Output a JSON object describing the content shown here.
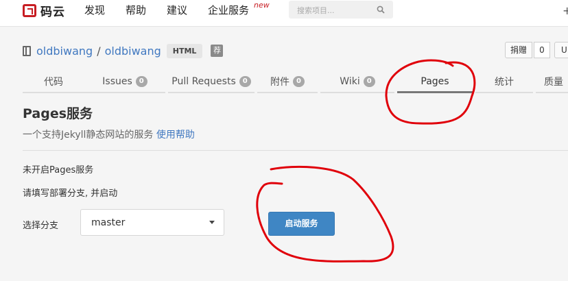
{
  "header": {
    "logo_text": "码云",
    "nav": [
      "发现",
      "帮助",
      "建议",
      "企业服务"
    ],
    "new_tag": "new",
    "search_placeholder": "搜索项目...",
    "plus": "+"
  },
  "repo": {
    "owner": "oldbiwang",
    "slash": "/",
    "name": "oldbiwang",
    "lang": "HTML",
    "recommend": "荐",
    "donate_label": "捐赠",
    "donate_count": "0",
    "watch_label": "U"
  },
  "tabs": [
    {
      "label": "代码",
      "count": ""
    },
    {
      "label": "Issues",
      "count": "0"
    },
    {
      "label": "Pull Requests",
      "count": "0"
    },
    {
      "label": "附件",
      "count": "0"
    },
    {
      "label": "Wiki",
      "count": "0"
    },
    {
      "label": "Pages",
      "count": ""
    },
    {
      "label": "统计",
      "count": ""
    },
    {
      "label": "质量",
      "count": ""
    }
  ],
  "pages": {
    "title": "Pages服务",
    "desc": "一个支持Jekyll静态网站的服务",
    "help_link": "使用帮助",
    "status": "未开启Pages服务",
    "hint": "请填写部署分支, 并启动",
    "branch_label": "选择分支",
    "branch_value": "master",
    "start_button": "启动服务"
  },
  "colors": {
    "accent": "#4078c0",
    "brand": "#c71d23",
    "button": "#3f86c4",
    "annotation": "#e0000a"
  }
}
